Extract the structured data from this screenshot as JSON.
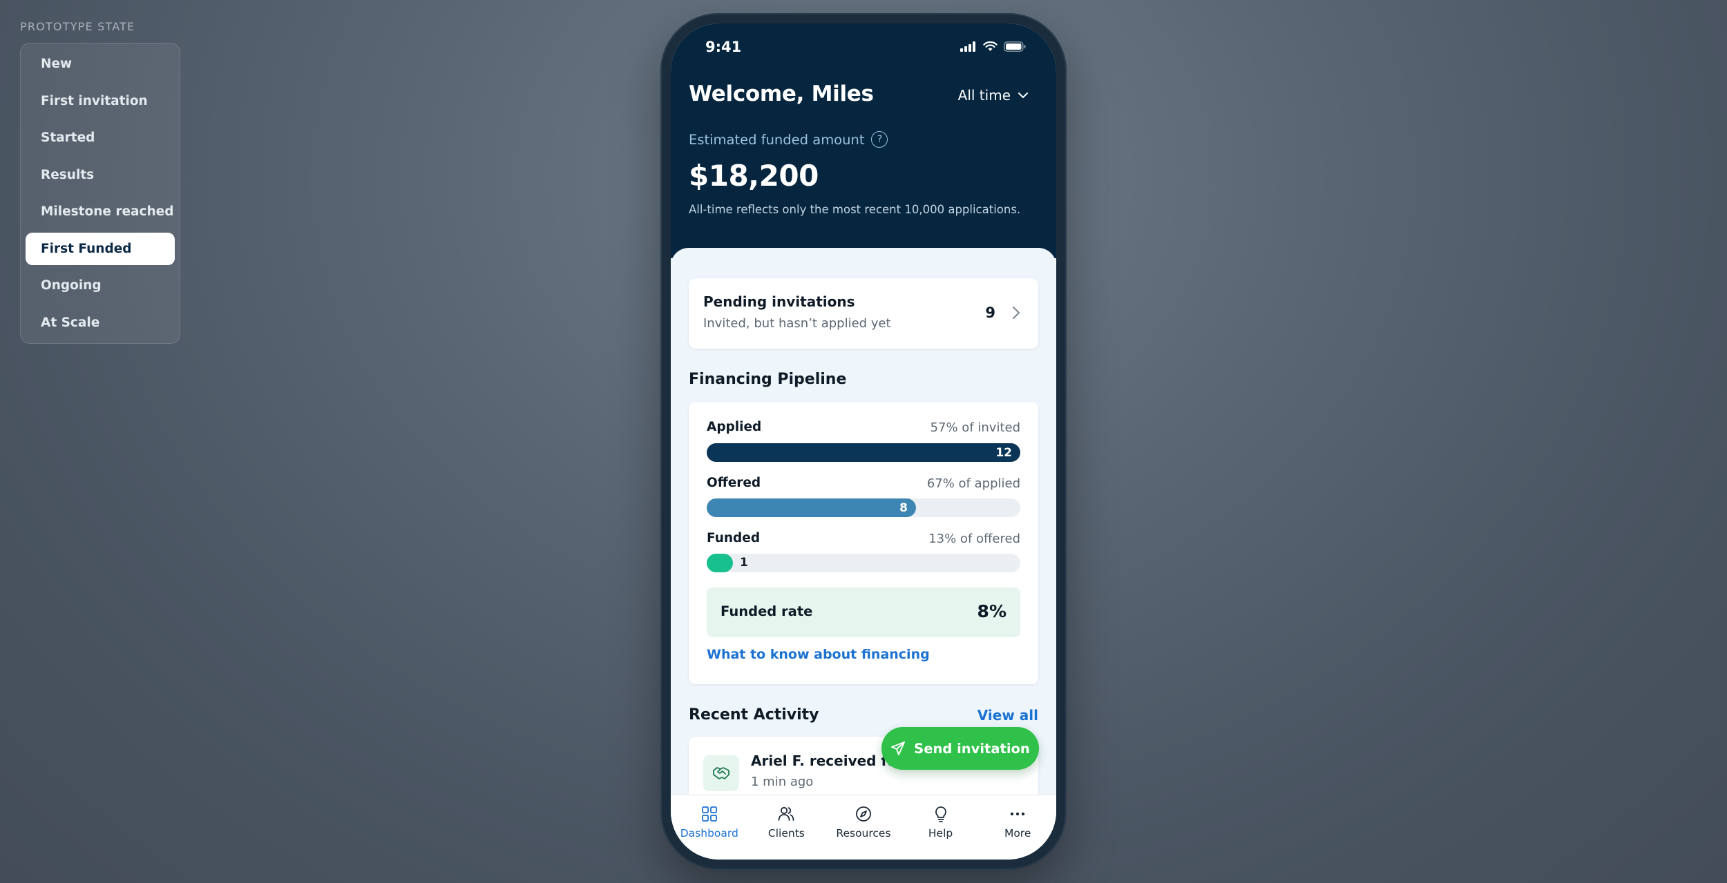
{
  "prototype": {
    "label": "PROTOTYPE STATE",
    "items": [
      "New",
      "First invitation",
      "Started",
      "Results",
      "Milestone reached",
      "First Funded",
      "Ongoing",
      "At Scale"
    ],
    "active_index": 5
  },
  "status_bar": {
    "time": "9:41"
  },
  "header": {
    "welcome": "Welcome, Miles",
    "period": "All time",
    "estimated_label": "Estimated funded amount",
    "help_glyph": "?",
    "amount": "$18,200",
    "note": "All-time reflects only the most recent 10,000 applications."
  },
  "pending": {
    "title": "Pending invitations",
    "subtitle": "Invited, but hasn’t applied yet",
    "count": "9"
  },
  "pipeline": {
    "title": "Financing Pipeline",
    "rows": [
      {
        "label": "Applied",
        "meta": "57% of invited",
        "value": "12",
        "fill_fraction": 1.0,
        "color": "#0b3556"
      },
      {
        "label": "Offered",
        "meta": "67% of applied",
        "value": "8",
        "fill_fraction": 0.667,
        "color": "#3d85b3"
      },
      {
        "label": "Funded",
        "meta": "13% of offered",
        "value": "1",
        "fill_fraction": 0.083,
        "color": "#18c08f"
      }
    ],
    "rate_label": "Funded rate",
    "rate_value": "8%",
    "link": "What to know about financing"
  },
  "activity": {
    "title": "Recent Activity",
    "view_all": "View all",
    "item_title": "Ariel F.  received funding",
    "item_time": "1 min ago"
  },
  "fab": {
    "label": "Send invitation"
  },
  "tabs": [
    {
      "label": "Dashboard",
      "icon": "grid-icon"
    },
    {
      "label": "Clients",
      "icon": "users-icon"
    },
    {
      "label": "Resources",
      "icon": "compass-icon"
    },
    {
      "label": "Help",
      "icon": "lightbulb-icon"
    },
    {
      "label": "More",
      "icon": "more-icon"
    }
  ],
  "colors": {
    "navy": "#06263f",
    "link_blue": "#1b72d1",
    "green_fab": "#2fc14a",
    "mint": "#e6f6ef"
  }
}
